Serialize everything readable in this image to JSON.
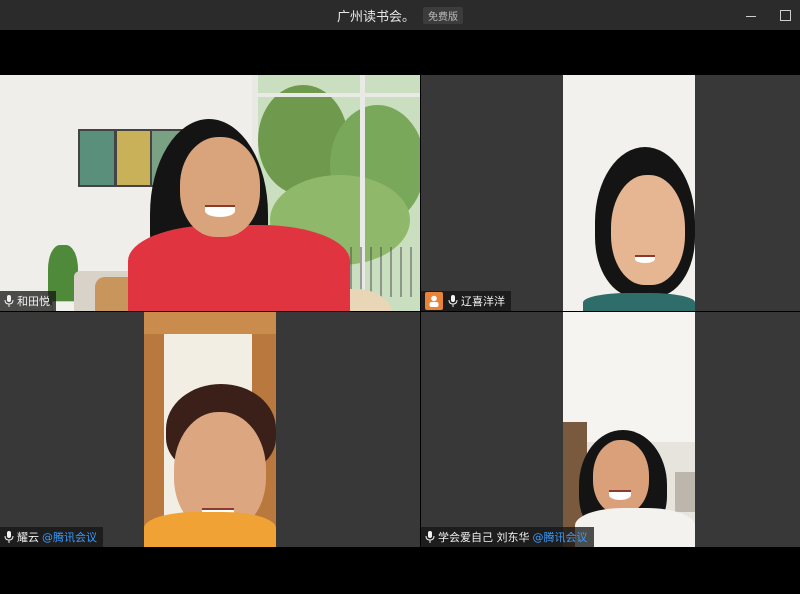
{
  "window": {
    "title": "广州读书会。",
    "badge": "免费版"
  },
  "controls": {
    "minimize_icon": "minimize-icon",
    "maximize_icon": "maximize-icon"
  },
  "colors": {
    "active_speaker_border": "#16a34a",
    "brand_blue": "#3b9cff",
    "avatar_orange": "#e8833a"
  },
  "participants": [
    {
      "name": "和田悦",
      "suffix": "",
      "active": true
    },
    {
      "name": "辽喜洋洋",
      "suffix": "",
      "active": false
    },
    {
      "name": "耀云",
      "suffix": "@腾讯会议",
      "active": false
    },
    {
      "name": "学会爱自己 刘东华",
      "suffix": "@腾讯会议",
      "active": false
    }
  ]
}
